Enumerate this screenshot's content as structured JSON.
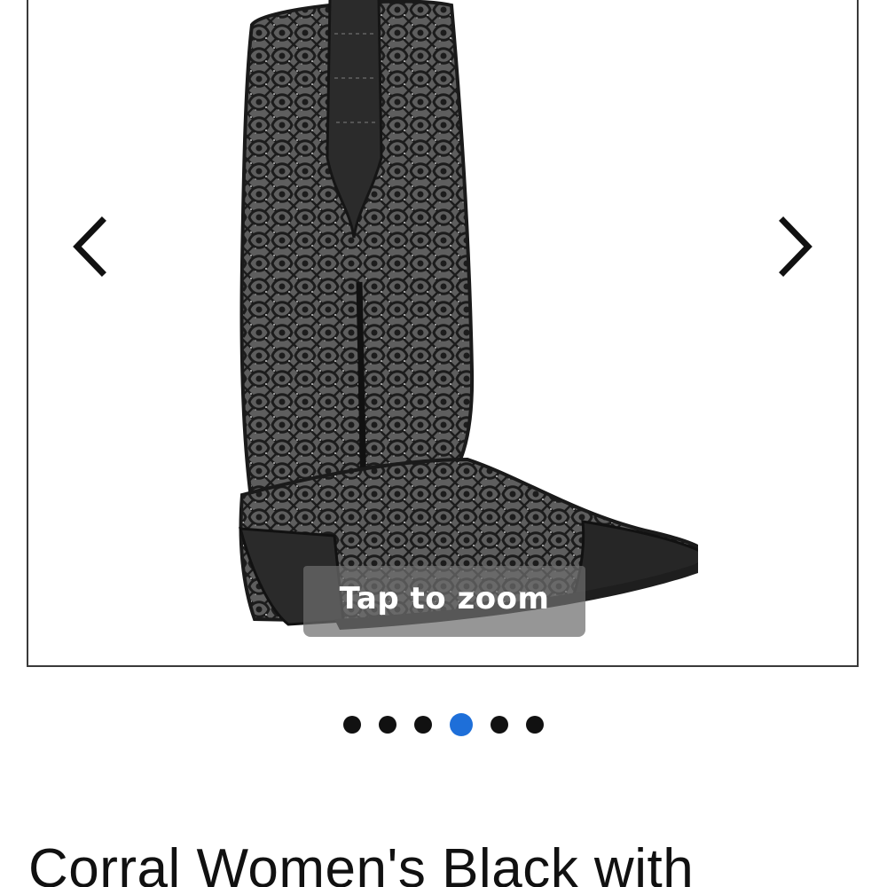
{
  "gallery": {
    "zoom_hint": "Tap to zoom",
    "prev_icon": "chevron-left-icon",
    "next_icon": "chevron-right-icon",
    "image_subject": "black embroidered cowboy boot",
    "slide_count": 6,
    "active_slide": 4
  },
  "product": {
    "title": "Corral Women's Black with"
  },
  "colors": {
    "accent": "#1e6fd9",
    "dot": "#111111",
    "border": "#3a3a3a"
  }
}
